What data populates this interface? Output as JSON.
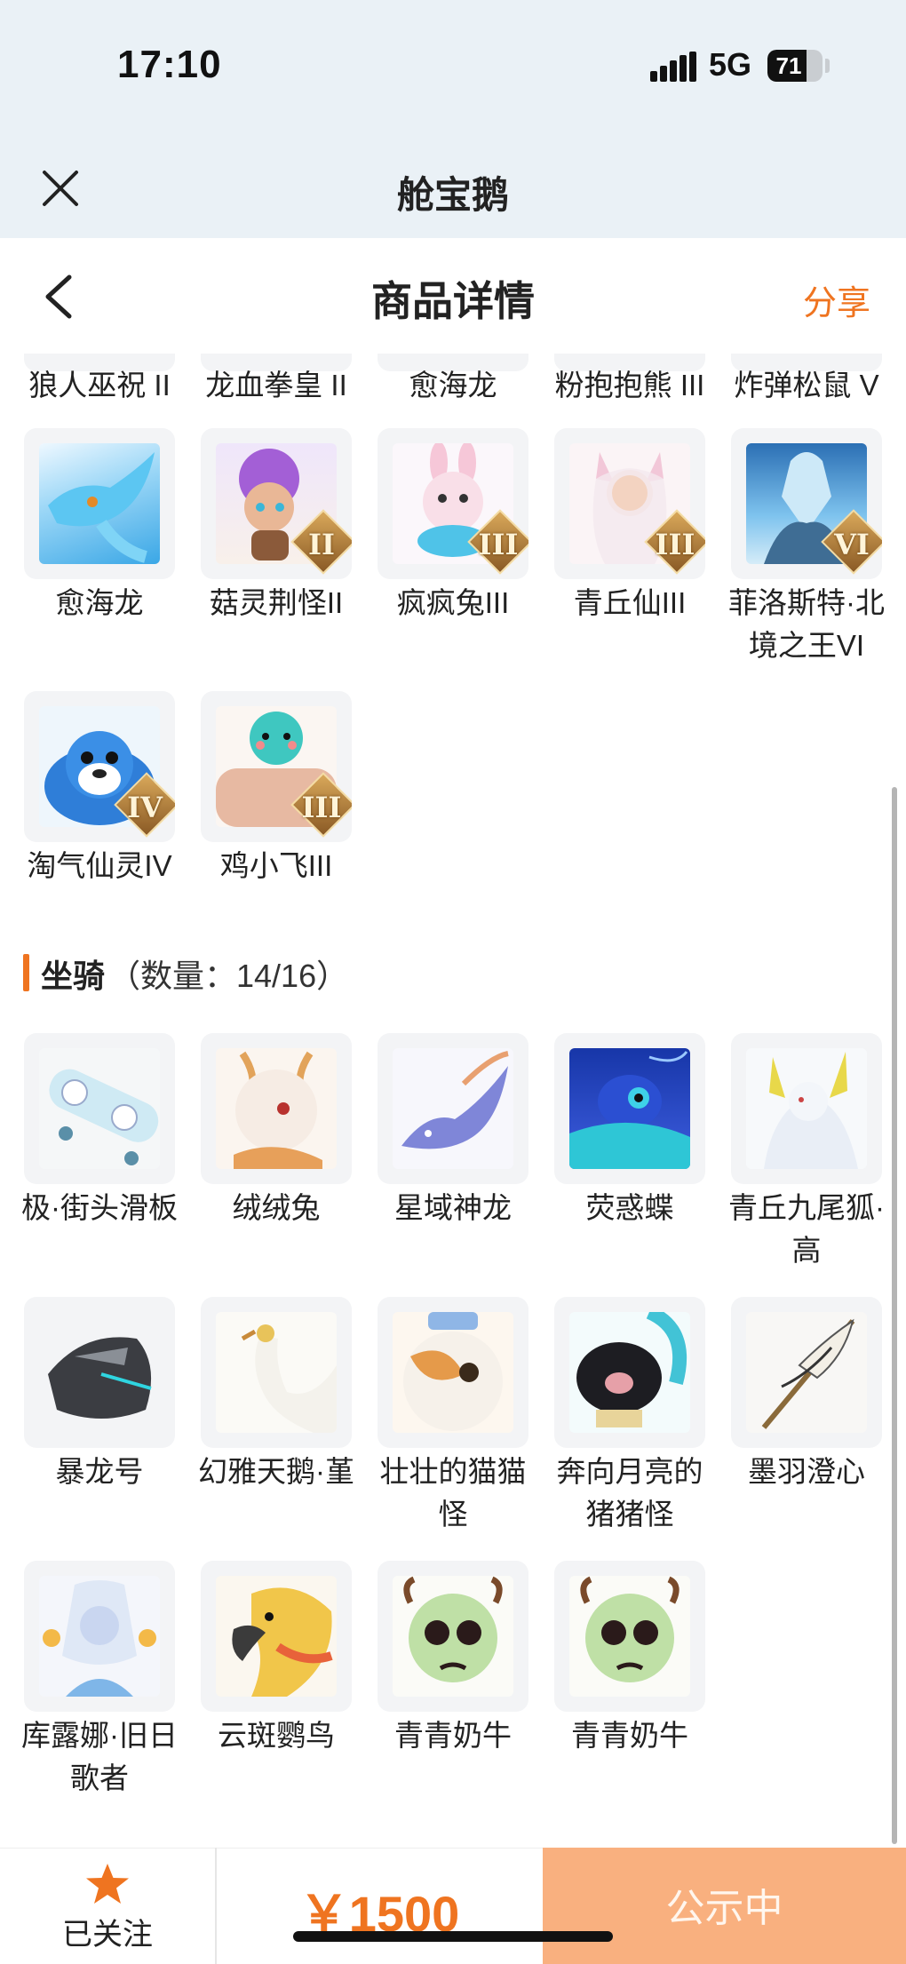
{
  "status_bar": {
    "time": "17:10",
    "network": "5G",
    "battery": "71",
    "battery_level": 0.71
  },
  "mini_header": {
    "title": "舱宝鹅"
  },
  "nav": {
    "title": "商品详情",
    "share_label": "分享"
  },
  "partial_row_labels": [
    "狼人巫祝 II",
    "龙血拳皇 II",
    "愈海龙",
    "粉抱抱熊 III",
    "炸弹松鼠 V"
  ],
  "pets": [
    {
      "name": "愈海龙",
      "badge": ""
    },
    {
      "name": "菇灵荆怪II",
      "badge": "II"
    },
    {
      "name": "疯疯兔III",
      "badge": "III"
    },
    {
      "name": "青丘仙III",
      "badge": "III"
    },
    {
      "name": "菲洛斯特·北境之王VI",
      "badge": "VI"
    },
    {
      "name": "淘气仙灵IV",
      "badge": "IV"
    },
    {
      "name": "鸡小飞III",
      "badge": "III"
    }
  ],
  "mounts_section": {
    "title": "坐骑",
    "count_text": "（数量：14/16）"
  },
  "mounts": [
    {
      "name": "极·街头滑板"
    },
    {
      "name": "绒绒兔"
    },
    {
      "name": "星域神龙"
    },
    {
      "name": "荧惑蝶"
    },
    {
      "name": "青丘九尾狐·高"
    },
    {
      "name": "暴龙号"
    },
    {
      "name": "幻雅天鹅·堇"
    },
    {
      "name": "壮壮的猫猫怪"
    },
    {
      "name": "奔向月亮的猪猪怪"
    },
    {
      "name": "墨羽澄心"
    },
    {
      "name": "库露娜·旧日歌者"
    },
    {
      "name": "云斑鹦鸟"
    },
    {
      "name": "青青奶牛"
    },
    {
      "name": "青青奶牛"
    }
  ],
  "bottom_bar": {
    "follow_label": "已关注",
    "price": "￥1500",
    "status_label": "公示中"
  },
  "colors": {
    "accent": "#ef7420",
    "status_button": "#f9b07f",
    "header_bg": "#eaf1f6"
  },
  "icons": [
    "close-icon",
    "back-icon",
    "star-icon",
    "signal-icon",
    "battery-icon"
  ]
}
